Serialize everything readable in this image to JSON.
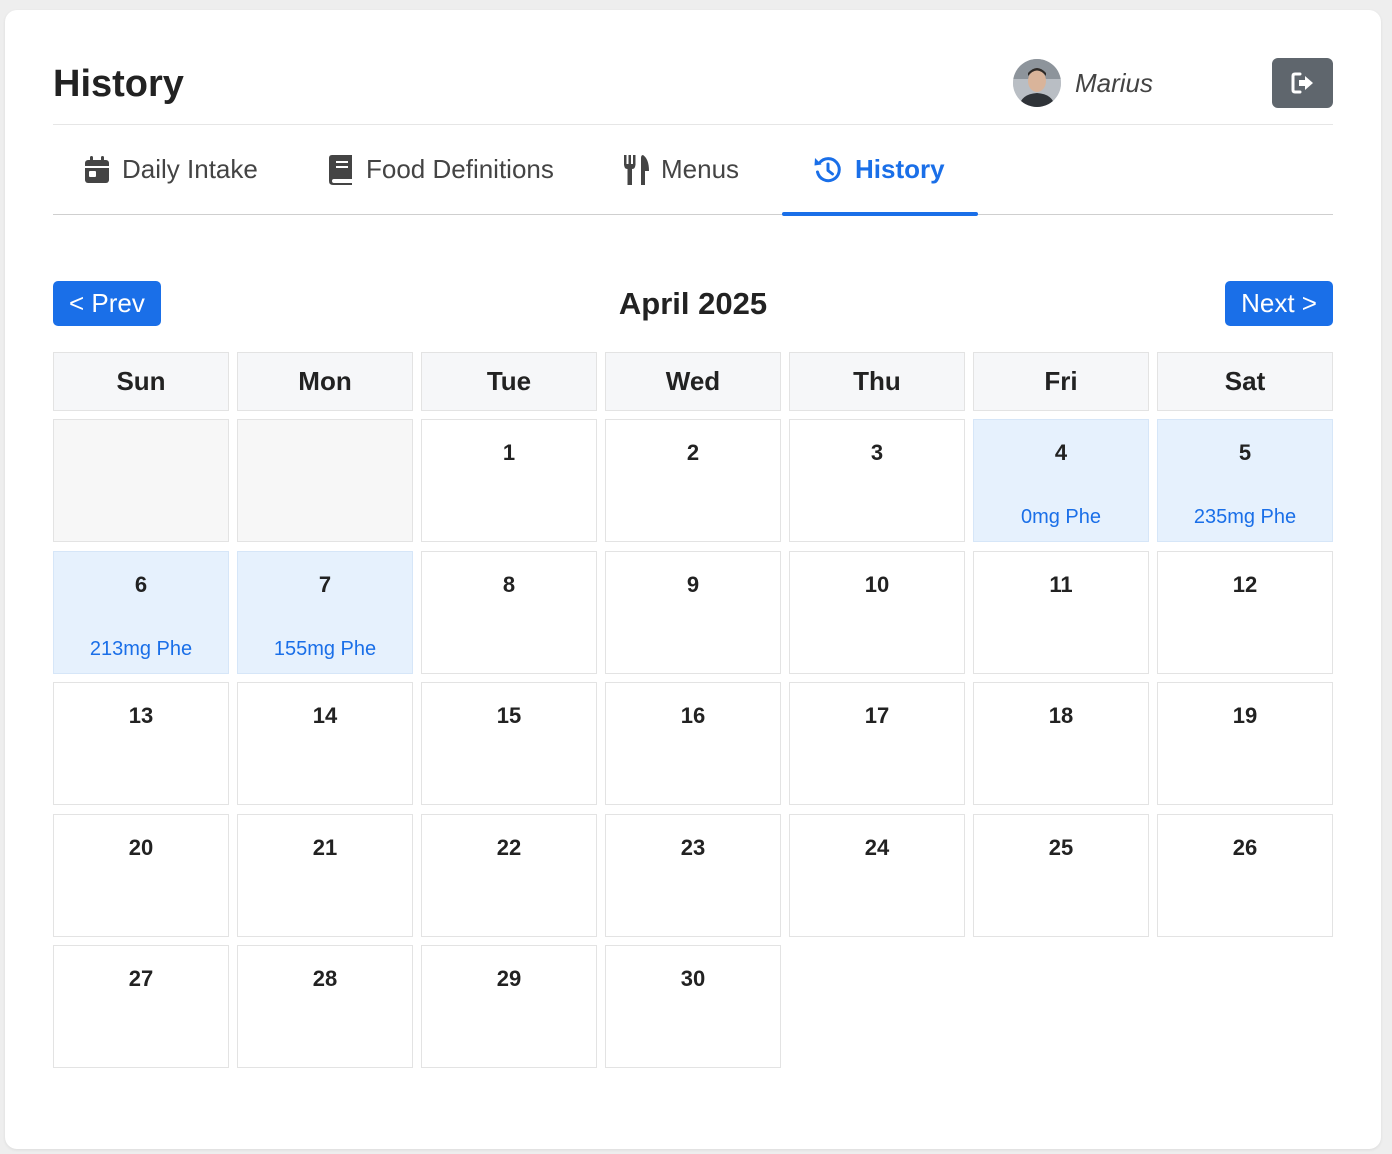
{
  "header": {
    "title": "History",
    "user_name": "Marius",
    "logout_icon": "logout-icon"
  },
  "tabs": [
    {
      "label": "Daily Intake",
      "icon": "calendar-icon",
      "active": false
    },
    {
      "label": "Food Definitions",
      "icon": "book-icon",
      "active": false
    },
    {
      "label": "Menus",
      "icon": "utensils-icon",
      "active": false
    },
    {
      "label": "History",
      "icon": "history-icon",
      "active": true
    }
  ],
  "calendar": {
    "month_label": "April 2025",
    "prev_label": "< Prev",
    "next_label": "Next >",
    "weekdays": [
      "Sun",
      "Mon",
      "Tue",
      "Wed",
      "Thu",
      "Fri",
      "Sat"
    ],
    "leading_empty_days": 2,
    "days": [
      {
        "day": "1",
        "phe": ""
      },
      {
        "day": "2",
        "phe": ""
      },
      {
        "day": "3",
        "phe": ""
      },
      {
        "day": "4",
        "phe": "0mg Phe"
      },
      {
        "day": "5",
        "phe": "235mg Phe"
      },
      {
        "day": "6",
        "phe": "213mg Phe"
      },
      {
        "day": "7",
        "phe": "155mg Phe"
      },
      {
        "day": "8",
        "phe": ""
      },
      {
        "day": "9",
        "phe": ""
      },
      {
        "day": "10",
        "phe": ""
      },
      {
        "day": "11",
        "phe": ""
      },
      {
        "day": "12",
        "phe": ""
      },
      {
        "day": "13",
        "phe": ""
      },
      {
        "day": "14",
        "phe": ""
      },
      {
        "day": "15",
        "phe": ""
      },
      {
        "day": "16",
        "phe": ""
      },
      {
        "day": "17",
        "phe": ""
      },
      {
        "day": "18",
        "phe": ""
      },
      {
        "day": "19",
        "phe": ""
      },
      {
        "day": "20",
        "phe": ""
      },
      {
        "day": "21",
        "phe": ""
      },
      {
        "day": "22",
        "phe": ""
      },
      {
        "day": "23",
        "phe": ""
      },
      {
        "day": "24",
        "phe": ""
      },
      {
        "day": "25",
        "phe": ""
      },
      {
        "day": "26",
        "phe": ""
      },
      {
        "day": "27",
        "phe": ""
      },
      {
        "day": "28",
        "phe": ""
      },
      {
        "day": "29",
        "phe": ""
      },
      {
        "day": "30",
        "phe": ""
      }
    ]
  },
  "colors": {
    "accent": "#1a6fe8",
    "highlight_day_bg": "#e6f1fd",
    "logout_bg": "#5f666d"
  }
}
